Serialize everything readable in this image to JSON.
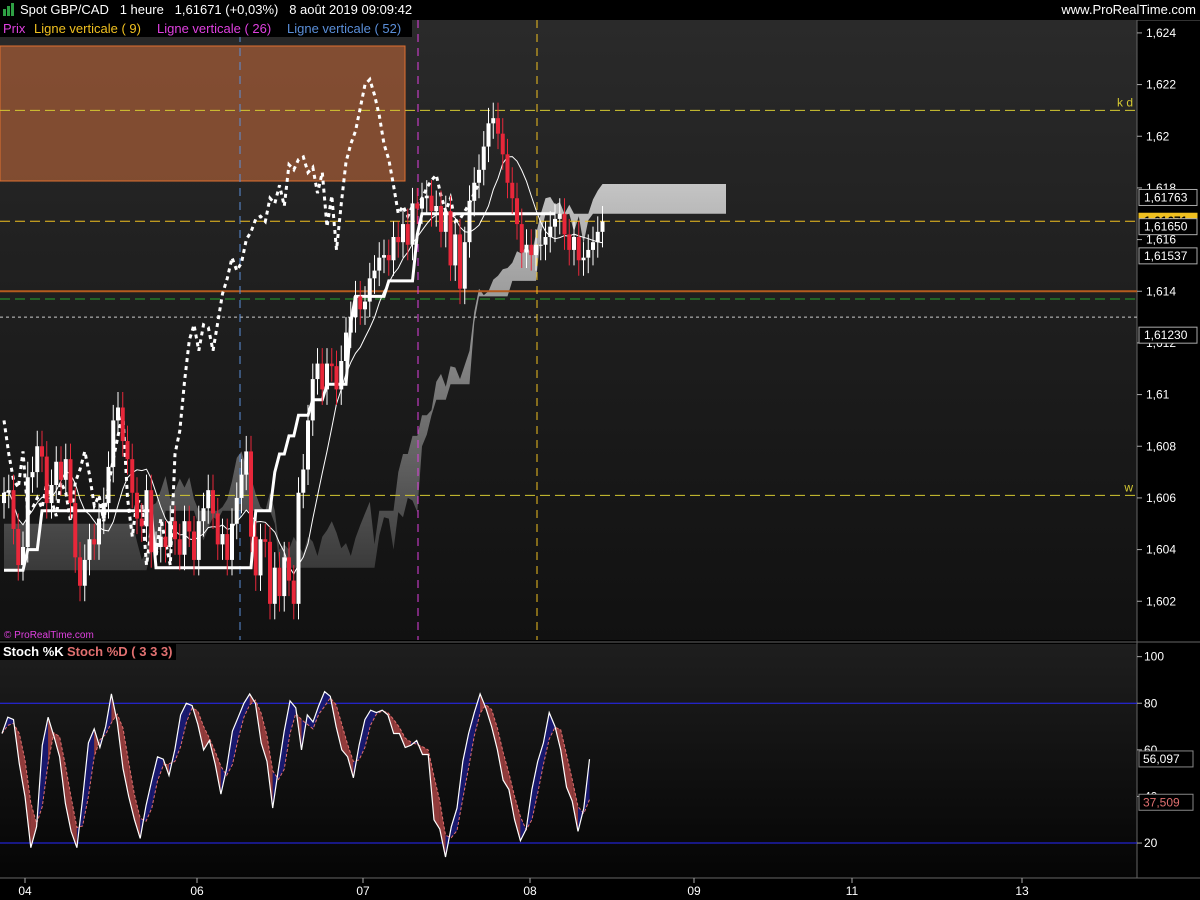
{
  "header": {
    "instrument": "Spot GBP/CAD",
    "timeframe": "1 heure",
    "price": "1,61671 (+0,03%)",
    "datetime": "8 août 2019 09:09:42",
    "site": "www.ProRealTime.com"
  },
  "legend": {
    "price": "Prix",
    "line9": "Ligne verticale ( 9)",
    "line26": "Ligne verticale ( 26)",
    "line52": "Ligne verticale ( 52)"
  },
  "watermark": "© ProRealTime.com",
  "colors": {
    "bull": "#ffffff",
    "bear": "#e8273a",
    "kijun": "#ffffff",
    "line9": "#f0c020",
    "line26": "#e040e0",
    "line52": "#5b8fd9",
    "stochK": "#ffffff",
    "stochD": "#e07070",
    "stochFillUp": "#1a1a7a",
    "stochFillDown": "#a04040"
  },
  "chart_data": [
    {
      "type": "candlestick",
      "panel": "price",
      "y_range": [
        1.6005,
        1.6245
      ],
      "y_ticks": [
        "1,624",
        "1,622",
        "1,62",
        "1,618",
        "1,616",
        "1,614",
        "1,612",
        "1,61",
        "1,608",
        "1,606",
        "1,604",
        "1,602"
      ],
      "x_ticks": [
        "04",
        "06",
        "07",
        "08",
        "09",
        "11",
        "13"
      ],
      "candles_close": [
        1.6062,
        1.6063,
        1.6048,
        1.6034,
        1.6041,
        1.6068,
        1.607,
        1.608,
        1.6076,
        1.6058,
        1.6065,
        1.6074,
        1.6067,
        1.6075,
        1.6058,
        1.6037,
        1.6026,
        1.6036,
        1.6044,
        1.6042,
        1.6052,
        1.6058,
        1.6072,
        1.609,
        1.6095,
        1.6082,
        1.6075,
        1.6062,
        1.6052,
        1.6049,
        1.6063,
        1.6039,
        1.6041,
        1.6045,
        1.6041,
        1.6051,
        1.6044,
        1.6038,
        1.6051,
        1.6047,
        1.6036,
        1.6051,
        1.6056,
        1.6063,
        1.6054,
        1.6042,
        1.6046,
        1.6036,
        1.605,
        1.606,
        1.6069,
        1.6078,
        1.6045,
        1.603,
        1.6044,
        1.6043,
        1.6019,
        1.6033,
        1.6022,
        1.6037,
        1.6028,
        1.6019,
        1.6062,
        1.6071,
        1.609,
        1.6106,
        1.6112,
        1.6102,
        1.6112,
        1.6111,
        1.6102,
        1.6113,
        1.6124,
        1.613,
        1.6138,
        1.6133,
        1.6136,
        1.6145,
        1.6148,
        1.6153,
        1.6154,
        1.6152,
        1.6161,
        1.6159,
        1.6166,
        1.6158,
        1.6174,
        1.6172,
        1.6176,
        1.6177,
        1.6171,
        1.6173,
        1.6163,
        1.6171,
        1.615,
        1.6162,
        1.6141,
        1.6159,
        1.6175,
        1.6182,
        1.6187,
        1.6196,
        1.6205,
        1.6207,
        1.6201,
        1.6193,
        1.6182,
        1.6176,
        1.6166,
        1.6155,
        1.6158,
        1.6154,
        1.6158,
        1.6158,
        1.6161,
        1.6165,
        1.6168,
        1.617,
        1.6162,
        1.6156,
        1.6161,
        1.6152,
        1.6153,
        1.6156,
        1.6159,
        1.6163,
        1.6167
      ],
      "kijun_sen": [
        1.6032,
        1.6032,
        1.6032,
        1.6032,
        1.6032,
        1.604,
        1.604,
        1.604,
        1.6055,
        1.6055,
        1.6055,
        1.6055,
        1.6055,
        1.6055,
        1.6055,
        1.6055,
        1.6055,
        1.6055,
        1.6055,
        1.6055,
        1.6055,
        1.6055,
        1.6055,
        1.6055,
        1.6055,
        1.6055,
        1.6055,
        1.6055,
        1.6055,
        1.6055,
        1.6055,
        1.6055,
        1.6033,
        1.6033,
        1.6033,
        1.6033,
        1.6033,
        1.6033,
        1.6033,
        1.6033,
        1.6033,
        1.6033,
        1.6033,
        1.6033,
        1.6033,
        1.6033,
        1.6033,
        1.6033,
        1.6033,
        1.6033,
        1.6033,
        1.6033,
        1.6033,
        1.6055,
        1.6055,
        1.6055,
        1.6055,
        1.607,
        1.6077,
        1.6077,
        1.6084,
        1.6084,
        1.6092,
        1.6092,
        1.6092,
        1.6098,
        1.6098,
        1.6098,
        1.6104,
        1.6104,
        1.6104,
        1.6104,
        1.6104,
        1.6128,
        1.6138,
        1.6138,
        1.6138,
        1.6138,
        1.6138,
        1.6138,
        1.6138,
        1.6144,
        1.6144,
        1.6144,
        1.6144,
        1.6144,
        1.6144,
        1.6162,
        1.617,
        1.617,
        1.617,
        1.617,
        1.617,
        1.617,
        1.617,
        1.617,
        1.617,
        1.617,
        1.617,
        1.617,
        1.617,
        1.617,
        1.617,
        1.617,
        1.617,
        1.617,
        1.617,
        1.617,
        1.617,
        1.617,
        1.617,
        1.617,
        1.617,
        1.617,
        1.617,
        1.617,
        1.617
      ],
      "levels": [
        {
          "price": 1.621,
          "label": "k d",
          "color": "#d4c832",
          "style": "dash"
        },
        {
          "price": 1.61671,
          "label": "1,61671",
          "color": "#f0c020",
          "style": "dash",
          "note": "current price"
        },
        {
          "price": 1.614,
          "color": "#b65b1e",
          "style": "solid"
        },
        {
          "price": 1.6137,
          "color": "#27a52e",
          "style": "dash"
        },
        {
          "price": 1.613,
          "color": "#cccccc",
          "style": "dot"
        },
        {
          "price": 1.6061,
          "label": "w",
          "color": "#d4c832",
          "style": "dash"
        }
      ],
      "right_labels": [
        "1,61763",
        "1,61671",
        "1,61650",
        "1,61537",
        "1,61230"
      ]
    },
    {
      "type": "line",
      "panel": "stochastic",
      "name_k": "Stoch %K",
      "name_d": "Stoch %D ( 3 3 3)",
      "y_range": [
        5,
        105
      ],
      "y_ticks": [
        "100",
        "80",
        "60",
        "40",
        "20"
      ],
      "bands": [
        80,
        20
      ],
      "k_values": [
        67,
        74,
        73,
        54,
        40,
        18,
        27,
        62,
        74,
        66,
        57,
        37,
        25,
        18,
        39,
        63,
        69,
        61,
        70,
        84,
        72,
        52,
        40,
        30,
        22,
        36,
        47,
        57,
        56,
        49,
        60,
        75,
        80,
        79,
        71,
        60,
        64,
        54,
        41,
        52,
        68,
        74,
        80,
        84,
        80,
        63,
        55,
        35,
        52,
        68,
        81,
        78,
        60,
        75,
        72,
        79,
        85,
        83,
        70,
        60,
        57,
        48,
        62,
        73,
        77,
        76,
        77,
        75,
        67,
        67,
        61,
        62,
        64,
        58,
        58,
        30,
        26,
        14,
        27,
        35,
        55,
        67,
        76,
        84,
        78,
        70,
        60,
        47,
        43,
        30,
        21,
        26,
        43,
        55,
        63,
        76,
        70,
        60,
        44,
        38,
        25,
        35,
        56
      ],
      "k_last_label": "56,097",
      "d_last_label": "37,509"
    }
  ]
}
